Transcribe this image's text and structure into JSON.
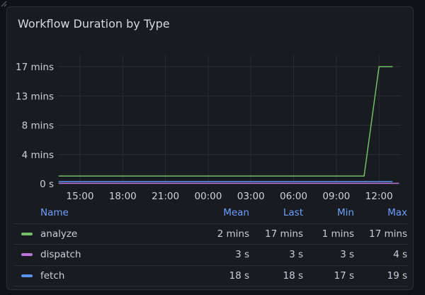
{
  "panel": {
    "title": "Workflow Duration by Type"
  },
  "chart_data": {
    "type": "line",
    "title": "Workflow Duration by Type",
    "xlabel": "",
    "ylabel": "",
    "x_unit": "hours (day1 0-24, day2 24-48)",
    "xlim": [
      13.5,
      37.4
    ],
    "ylim": [
      0,
      1020
    ],
    "y_ticks": [
      {
        "v": 0,
        "label": "0 s"
      },
      {
        "v": 255,
        "label": "4 mins"
      },
      {
        "v": 510,
        "label": "8 mins"
      },
      {
        "v": 765,
        "label": "13 mins"
      },
      {
        "v": 1020,
        "label": "17 mins"
      }
    ],
    "x_ticks": [
      {
        "v": 15,
        "label": "15:00"
      },
      {
        "v": 18,
        "label": "18:00"
      },
      {
        "v": 21,
        "label": "21:00"
      },
      {
        "v": 24,
        "label": "00:00"
      },
      {
        "v": 27,
        "label": "03:00"
      },
      {
        "v": 30,
        "label": "06:00"
      },
      {
        "v": 33,
        "label": "09:00"
      },
      {
        "v": 36,
        "label": "12:00"
      }
    ],
    "grid": true,
    "series": [
      {
        "name": "analyze",
        "color": "#73bf69",
        "points": [
          [
            13.5,
            66
          ],
          [
            34.95,
            66
          ],
          [
            36,
            1020
          ],
          [
            36.95,
            1020
          ]
        ]
      },
      {
        "name": "dispatch",
        "color": "#b877d9",
        "points": [
          [
            13.5,
            3
          ],
          [
            37.4,
            3
          ]
        ]
      },
      {
        "name": "fetch",
        "color": "#5794f2",
        "points": [
          [
            13.5,
            18
          ],
          [
            36.95,
            18
          ]
        ]
      }
    ]
  },
  "legend": {
    "headers": {
      "name": "Name",
      "mean": "Mean",
      "last": "Last",
      "min": "Min",
      "max": "Max"
    },
    "rows": [
      {
        "name": "analyze",
        "color": "#73bf69",
        "mean": "2 mins",
        "last": "17 mins",
        "min": "1 mins",
        "max": "17 mins"
      },
      {
        "name": "dispatch",
        "color": "#b877d9",
        "mean": "3 s",
        "last": "3 s",
        "min": "3 s",
        "max": "4 s"
      },
      {
        "name": "fetch",
        "color": "#5794f2",
        "mean": "18 s",
        "last": "18 s",
        "min": "17 s",
        "max": "19 s"
      }
    ]
  }
}
